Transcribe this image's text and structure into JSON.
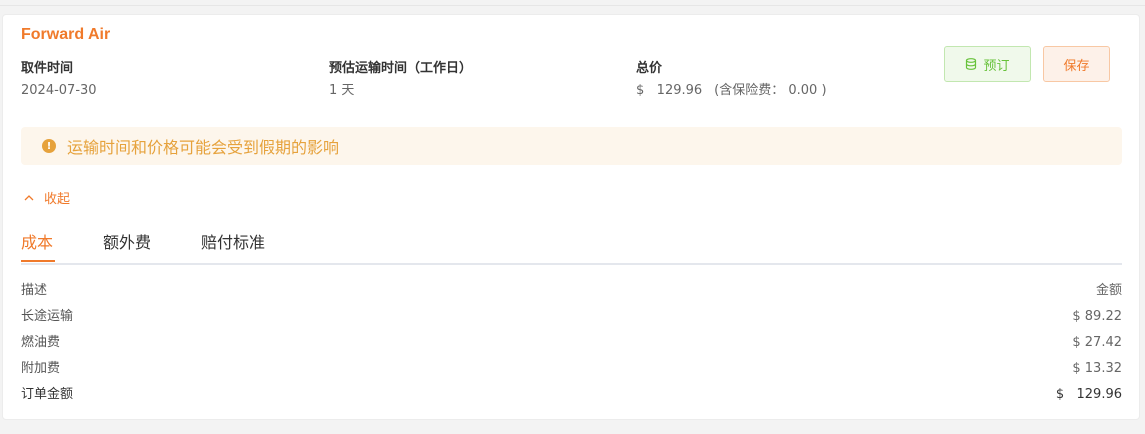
{
  "carrier": "Forward Air",
  "info": {
    "pickup_label": "取件时间",
    "pickup_value": "2024-07-30",
    "transit_label": "预估运输时间（工作日）",
    "transit_value": "1 天",
    "total_label": "总价",
    "total_value": "$   129.96",
    "insurance_value": "(含保险费： 0.00 )"
  },
  "buttons": {
    "book_label": "预订",
    "save_label": "保存"
  },
  "notice": {
    "text": "运输时间和价格可能会受到假期的影响",
    "icon": "warning-icon"
  },
  "collapse_label": "收起",
  "tabs": [
    {
      "label": "成本",
      "active": true
    },
    {
      "label": "额外费",
      "active": false
    },
    {
      "label": "赔付标准",
      "active": false
    }
  ],
  "table": {
    "header": {
      "desc": "描述",
      "amount": "金额"
    },
    "rows": [
      {
        "desc": "长途运输",
        "amount": "$ 89.22"
      },
      {
        "desc": "燃油费",
        "amount": "$ 27.42"
      },
      {
        "desc": "附加费",
        "amount": "$ 13.32"
      }
    ],
    "total": {
      "desc": "订单金额",
      "amount": "$   129.96"
    }
  },
  "colors": {
    "accent": "#f07a2b",
    "success": "#67c23a",
    "warning": "#e6a23c"
  }
}
